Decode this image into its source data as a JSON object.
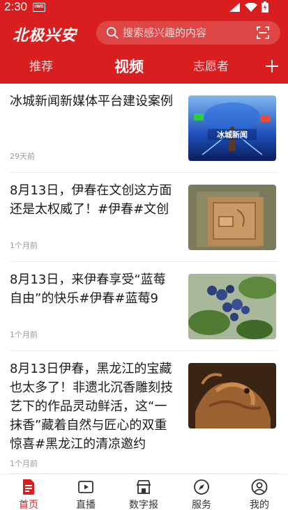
{
  "status": {
    "time": "2:30",
    "chip": "HMS"
  },
  "header": {
    "logo": "北极兴安",
    "search_placeholder": "搜索感兴趣的内容"
  },
  "tabs": [
    {
      "label": "推荐",
      "active": false
    },
    {
      "label": "视频",
      "active": true
    },
    {
      "label": "志愿者",
      "active": false
    }
  ],
  "news": [
    {
      "title": "冰城新闻新媒体平台建设案例",
      "time": "29天前",
      "thumb_text": "冰城新闻"
    },
    {
      "title": "8月13日，伊春在文创这方面还是太权威了！#伊春#文创",
      "time": "1个月前",
      "thumb_text": ""
    },
    {
      "title": "8月13日，来伊春享受“蓝莓自由”的快乐#伊春#蓝莓9",
      "time": "1个月前",
      "thumb_text": ""
    },
    {
      "title": "8月13日伊春，黑龙江的宝藏也太多了！非遗北沉香雕刻技艺下的作品灵动鲜活，这“一抹香”藏着自然与匠心的双重惊喜#黑龙江的清凉邀约",
      "time": "1个月前",
      "thumb_text": ""
    }
  ],
  "bottom_nav": [
    {
      "label": "首页",
      "icon": "home-doc-icon",
      "active": true
    },
    {
      "label": "直播",
      "icon": "live-video-icon",
      "active": false
    },
    {
      "label": "数字报",
      "icon": "newspaper-store-icon",
      "active": false
    },
    {
      "label": "服务",
      "icon": "compass-icon",
      "active": false
    },
    {
      "label": "我的",
      "icon": "user-icon",
      "active": false
    }
  ],
  "colors": {
    "brand_red": "#d81e1e",
    "text": "#1a1a1a",
    "meta": "#999999"
  }
}
